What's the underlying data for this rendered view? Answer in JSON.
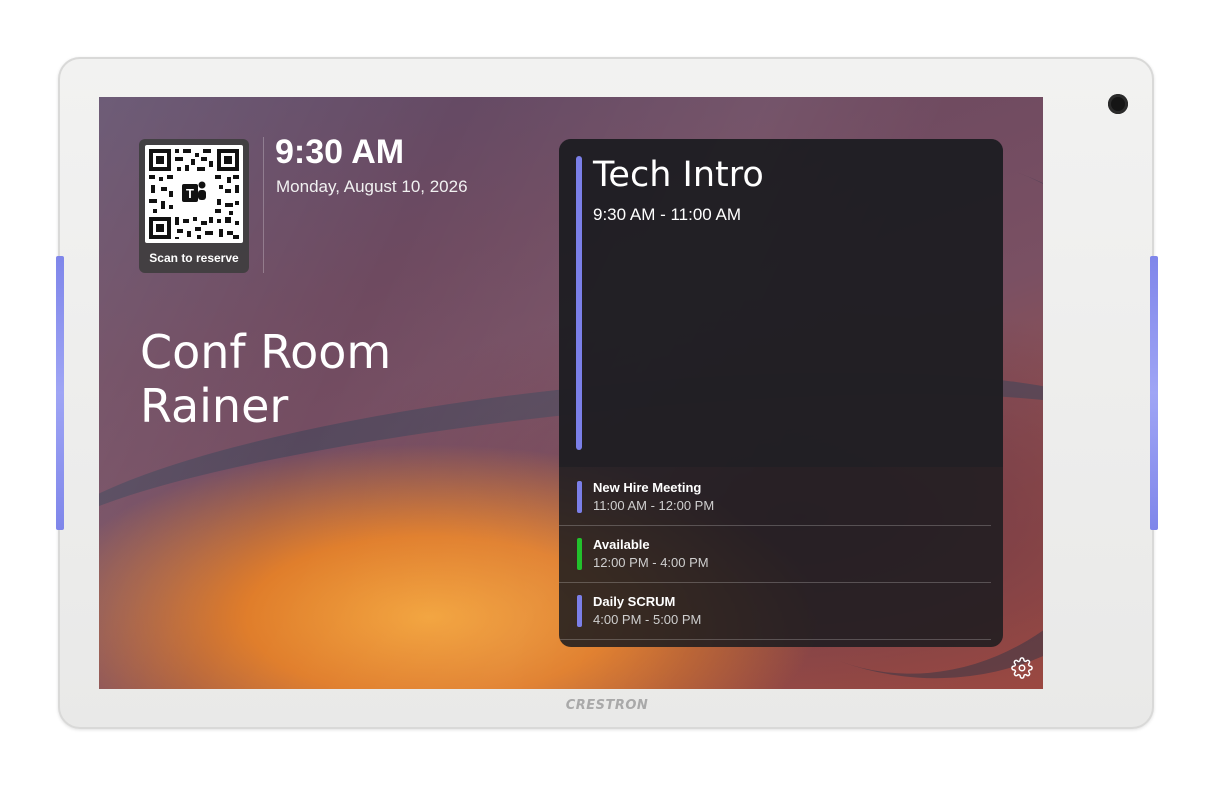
{
  "device": {
    "brand": "CRESTRON",
    "led_color": "#8a90ef"
  },
  "qr": {
    "label": "Scan to reserve",
    "center_icon": "teams-icon"
  },
  "clock": {
    "time": "9:30 AM",
    "date": "Monday, August 10, 2026"
  },
  "room": {
    "line1": "Conf Room",
    "line2": "Rainer"
  },
  "current_meeting": {
    "title": "Tech Intro",
    "time": "9:30 AM - 11:00 AM",
    "accent": "#7b7fe8"
  },
  "schedule": [
    {
      "title": "New Hire Meeting",
      "time": "11:00 AM - 12:00 PM",
      "color": "#7b7fe8"
    },
    {
      "title": "Available",
      "time": "12:00 PM - 4:00 PM",
      "color": "#22c02c"
    },
    {
      "title": "Daily SCRUM",
      "time": "4:00 PM - 5:00 PM",
      "color": "#7b7fe8"
    }
  ],
  "settings_icon": "gear-icon"
}
